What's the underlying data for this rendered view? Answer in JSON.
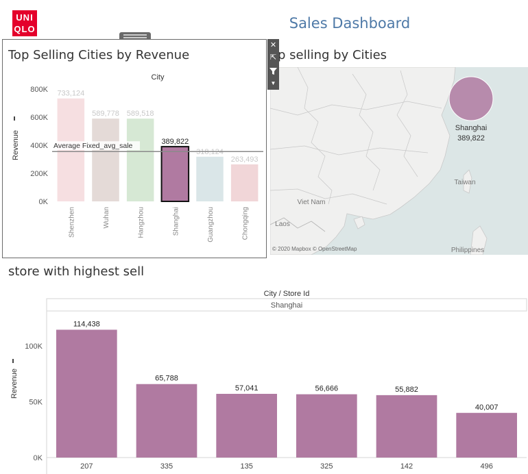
{
  "brand": {
    "logo_line1": "UNI",
    "logo_line2": "QLO"
  },
  "dashboard_title": "Sales Dashboard",
  "map_panel": {
    "title": "op selling by Cities",
    "bubble_label": "Shanghai",
    "bubble_value": "389,822",
    "place_labels": [
      "Taiwan",
      "Viet Nam",
      "Laos",
      "Philippines"
    ],
    "credit": "© 2020 Mapbox © OpenStreetMap"
  },
  "tooltip_toolbar": {
    "icons": [
      "close-icon",
      "open-in-new-icon",
      "filter-icon",
      "dropdown-icon"
    ]
  },
  "colors": {
    "accent": "#4e79a7",
    "store_bar": "#b07aa1",
    "selected_bar": "#b07aa1",
    "brand_red": "#e4002b"
  },
  "chart_data": [
    {
      "type": "bar",
      "title": "Top Selling Cities by Revenue",
      "header": "City",
      "ylabel": "Revenue",
      "categories": [
        "Shenzhen",
        "Wuhan",
        "Hangzhou",
        "Shanghai",
        "Guangzhou",
        "Chongqing"
      ],
      "values": [
        733124,
        589778,
        589518,
        389822,
        318124,
        263493
      ],
      "value_labels": [
        "733,124",
        "589,778",
        "589,518",
        "389,822",
        "318,124",
        "263,493"
      ],
      "bar_colors": [
        "#f6dfe1",
        "#e4dad7",
        "#d6e8d4",
        "#b07aa1",
        "#dae6e8",
        "#f1d6d8"
      ],
      "selected": "Shanghai",
      "ylim": [
        0,
        800000
      ],
      "yticks": [
        0,
        200000,
        400000,
        600000,
        800000
      ],
      "ytick_labels": [
        "0K",
        "200K",
        "400K",
        "600K",
        "800K"
      ],
      "reference_line": {
        "label": "Average Fixed_avg_sale",
        "value": 355000
      }
    },
    {
      "type": "bar",
      "title": "store with highest sell",
      "header": "City / Store Id",
      "subheader": "Shanghai",
      "ylabel": "Revenue",
      "categories": [
        "207",
        "335",
        "135",
        "325",
        "142",
        "496"
      ],
      "values": [
        114438,
        65788,
        57041,
        56666,
        55882,
        40007
      ],
      "value_labels": [
        "114,438",
        "65,788",
        "57,041",
        "56,666",
        "55,882",
        "40,007"
      ],
      "ylim": [
        0,
        130000
      ],
      "yticks": [
        0,
        50000,
        100000
      ],
      "ytick_labels": [
        "0K",
        "50K",
        "100K"
      ]
    }
  ]
}
